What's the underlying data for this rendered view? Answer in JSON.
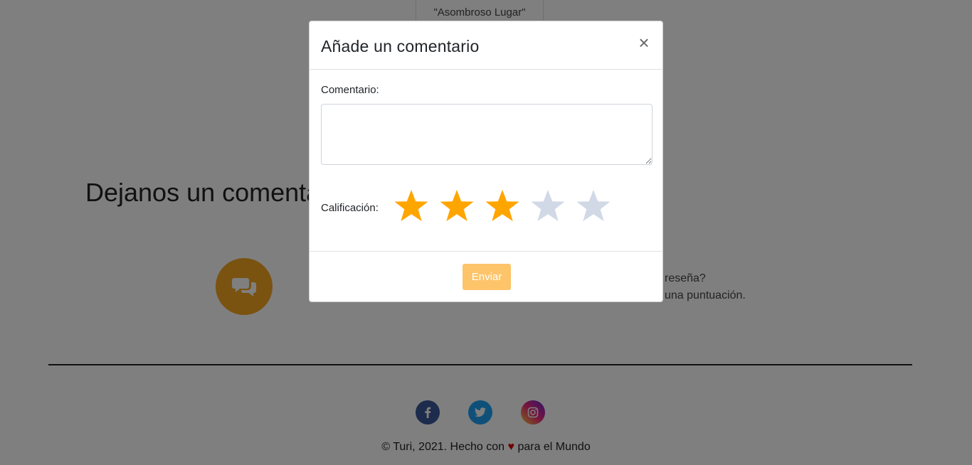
{
  "background": {
    "quote": "\"Asombroso Lugar\"",
    "section_heading": "Dejanos un comentario",
    "review_prompt_line1": "reseña?",
    "review_prompt_line2": "una puntuación.",
    "copyright_prefix": "© Turi, 2021. Hecho con",
    "copyright_suffix": "para el Mundo",
    "heart": "♥"
  },
  "modal": {
    "title": "Añade un comentario",
    "close_symbol": "×",
    "comment_label": "Comentario:",
    "comment_value": "",
    "rating_label": "Calificación:",
    "rating": 3,
    "rating_max": 5,
    "submit_label": "Enviar"
  },
  "colors": {
    "star_filled": "#ffa500",
    "star_empty": "#d1d8e6",
    "accent": "#fdc46a"
  }
}
